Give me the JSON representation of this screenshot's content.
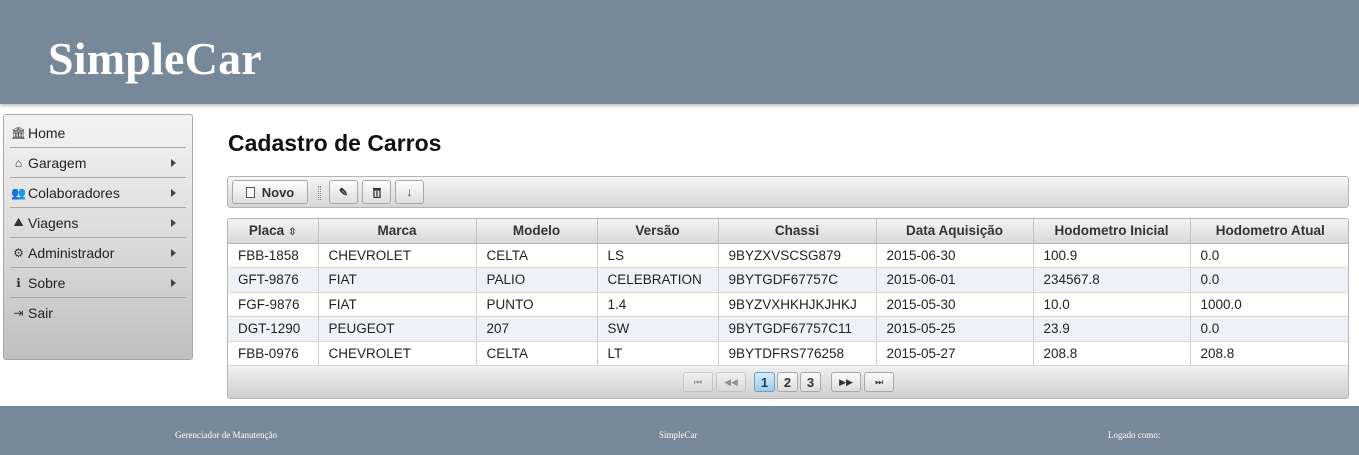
{
  "header": {
    "brand": "SimpleCar"
  },
  "sidebar": {
    "items": [
      {
        "label": "Home",
        "icon": "bank-icon",
        "glyph": "🏛",
        "has_submenu": false
      },
      {
        "label": "Garagem",
        "icon": "home-icon",
        "glyph": "⌂",
        "has_submenu": true
      },
      {
        "label": "Colaboradores",
        "icon": "users-icon",
        "glyph": "👥",
        "has_submenu": true
      },
      {
        "label": "Viagens",
        "icon": "binoculars-icon",
        "glyph": "⛰",
        "has_submenu": true
      },
      {
        "label": "Administrador",
        "icon": "gears-icon",
        "glyph": "⚙",
        "has_submenu": true
      },
      {
        "label": "Sobre",
        "icon": "info-icon",
        "glyph": "ℹ",
        "has_submenu": true
      },
      {
        "label": "Sair",
        "icon": "sign-out-icon",
        "glyph": "⇥",
        "has_submenu": false
      }
    ]
  },
  "main": {
    "title": "Cadastro de Carros",
    "toolbar": {
      "new_label": "Novo",
      "edit_icon": "pencil-icon",
      "delete_icon": "trash-icon",
      "export_icon": "download-icon"
    }
  },
  "table": {
    "columns": [
      "Placa",
      "Marca",
      "Modelo",
      "Versão",
      "Chassi",
      "Data Aquisição",
      "Hodometro Inicial",
      "Hodometro Atual"
    ],
    "sorted_column": "Placa",
    "rows": [
      [
        "FBB-1858",
        "CHEVROLET",
        "CELTA",
        "LS",
        "9BYZXVSCSG879",
        "2015-06-30",
        "100.9",
        "0.0"
      ],
      [
        "GFT-9876",
        "FIAT",
        "PALIO",
        "CELEBRATION",
        "9BYTGDF67757C",
        "2015-06-01",
        "234567.8",
        "0.0"
      ],
      [
        "FGF-9876",
        "FIAT",
        "PUNTO",
        "1.4",
        "9BYZVXHKHJKJHKJ",
        "2015-05-30",
        "10.0",
        "1000.0"
      ],
      [
        "DGT-1290",
        "PEUGEOT",
        "207",
        "SW",
        "9BYTGDF67757C11",
        "2015-05-25",
        "23.9",
        "0.0"
      ],
      [
        "FBB-0976",
        "CHEVROLET",
        "CELTA",
        "LT",
        "9BYTDFRS776258",
        "2015-05-27",
        "208.8",
        "208.8"
      ]
    ]
  },
  "paginator": {
    "first": "⏮",
    "prev": "◀◀",
    "next": "▶▶",
    "last": "⏭",
    "pages": [
      "1",
      "2",
      "3"
    ],
    "current_page": "1"
  },
  "footer": {
    "left": "Gerenciador de Manutenção",
    "center": "SimpleCar",
    "right": "Logado como:"
  },
  "colors": {
    "header_bg": "#778899",
    "footer_bg": "#778899",
    "active_page": "#9fcbe8"
  }
}
